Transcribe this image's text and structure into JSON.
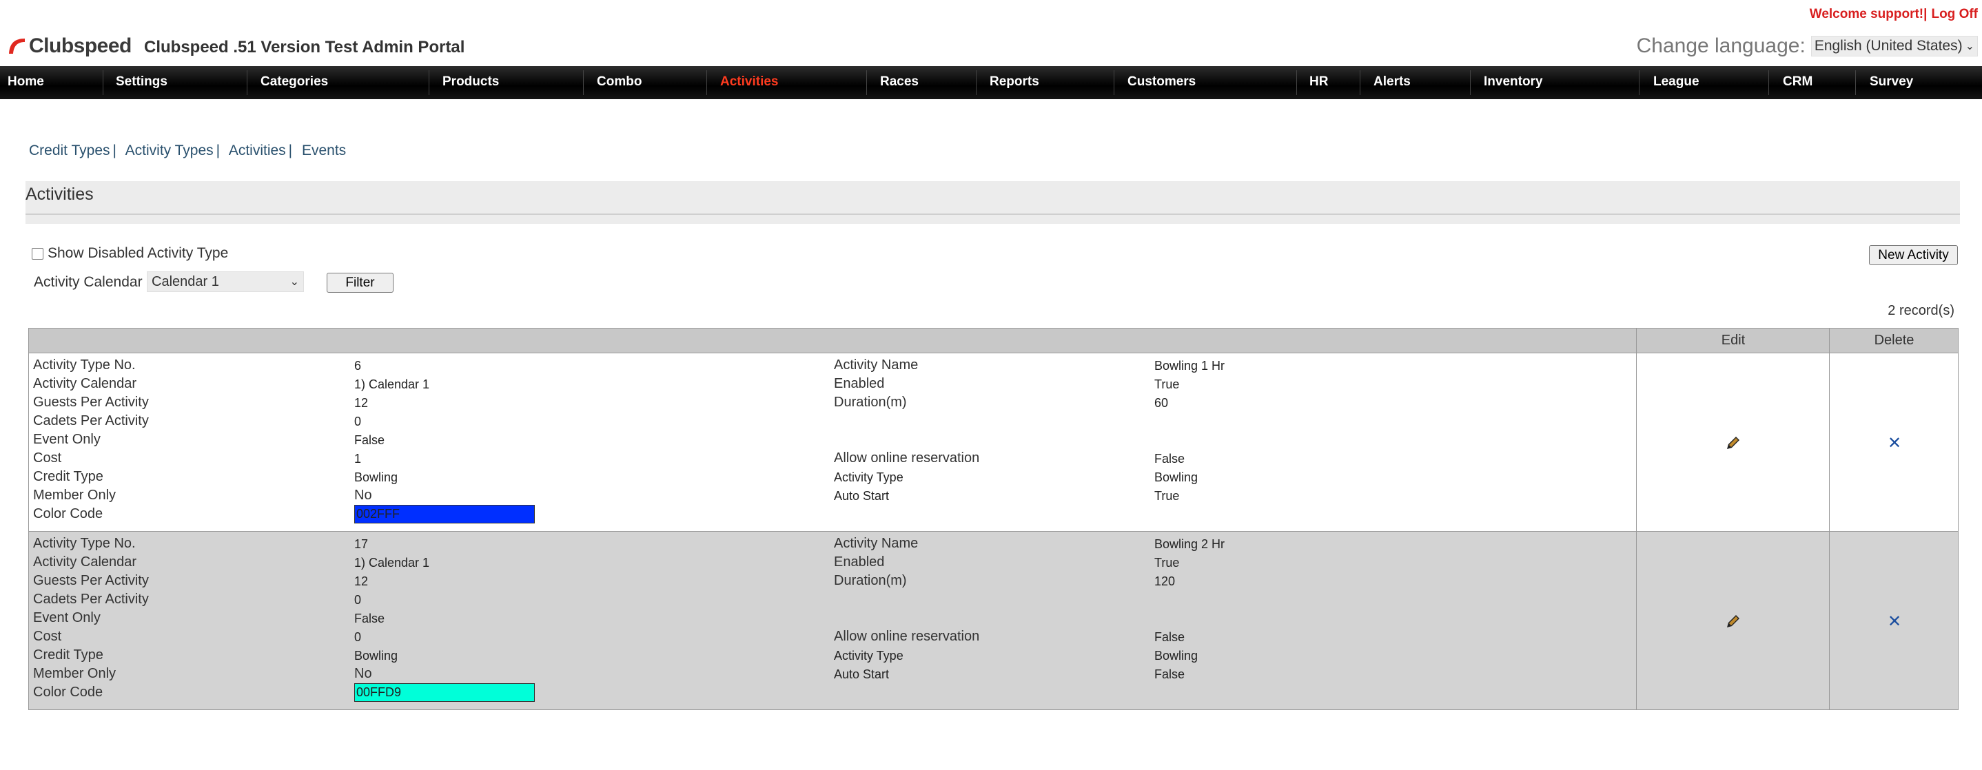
{
  "header": {
    "welcome": "Welcome support!",
    "logoff": "Log Off",
    "logo_text": "Clubspeed",
    "portal_title": "Clubspeed .51 Version Test Admin Portal",
    "language_label": "Change language:",
    "language_value": "English (United States)"
  },
  "nav": {
    "items": [
      "Home",
      "Settings",
      "Categories",
      "Products",
      "Combo",
      "Activities",
      "Races",
      "Reports",
      "Customers",
      "HR",
      "Alerts",
      "Inventory",
      "League",
      "CRM",
      "Survey"
    ],
    "active": "Activities"
  },
  "sublinks": [
    "Credit Types",
    "Activity Types",
    "Activities",
    "Events"
  ],
  "section_title": "Activities",
  "controls": {
    "show_disabled_label": "Show Disabled Activity Type",
    "show_disabled_checked": false,
    "calendar_label": "Activity Calendar",
    "calendar_value": "Calendar 1",
    "filter_label": "Filter",
    "new_activity_label": "New Activity",
    "records": "2 record(s)"
  },
  "table": {
    "headers": {
      "edit": "Edit",
      "delete": "Delete"
    },
    "labels": {
      "type_no": "Activity Type No.",
      "calendar": "Activity Calendar",
      "guests": "Guests Per Activity",
      "cadets": "Cadets Per Activity",
      "event_only": "Event Only",
      "cost": "Cost",
      "credit_type": "Credit Type",
      "member_only": "Member Only",
      "color_code": "Color Code",
      "activity_name": "Activity Name",
      "enabled": "Enabled",
      "duration": "Duration(m)",
      "online": "Allow online reservation",
      "activity_type": "Activity Type",
      "auto_start": "Auto Start"
    },
    "rows": [
      {
        "type_no": "6",
        "calendar": "1) Calendar 1",
        "guests": "12",
        "cadets": "0",
        "event_only": "False",
        "cost": "1",
        "credit_type": "Bowling",
        "member_only": "No",
        "color_code": "002FFF",
        "color_hex": "#002FFF",
        "activity_name": "Bowling 1 Hr",
        "enabled": "True",
        "duration": "60",
        "online": "False",
        "activity_type": "Bowling",
        "auto_start": "True"
      },
      {
        "type_no": "17",
        "calendar": "1) Calendar 1",
        "guests": "12",
        "cadets": "0",
        "event_only": "False",
        "cost": "0",
        "credit_type": "Bowling",
        "member_only": "No",
        "color_code": "00FFD9",
        "color_hex": "#00FFD9",
        "activity_name": "Bowling 2 Hr",
        "enabled": "True",
        "duration": "120",
        "online": "False",
        "activity_type": "Bowling",
        "auto_start": "False"
      }
    ]
  },
  "colors": {
    "brand_red": "#d81e1e",
    "nav_active": "#ff3b1f",
    "link": "#29506d",
    "delete_icon": "#1a4d9e"
  }
}
